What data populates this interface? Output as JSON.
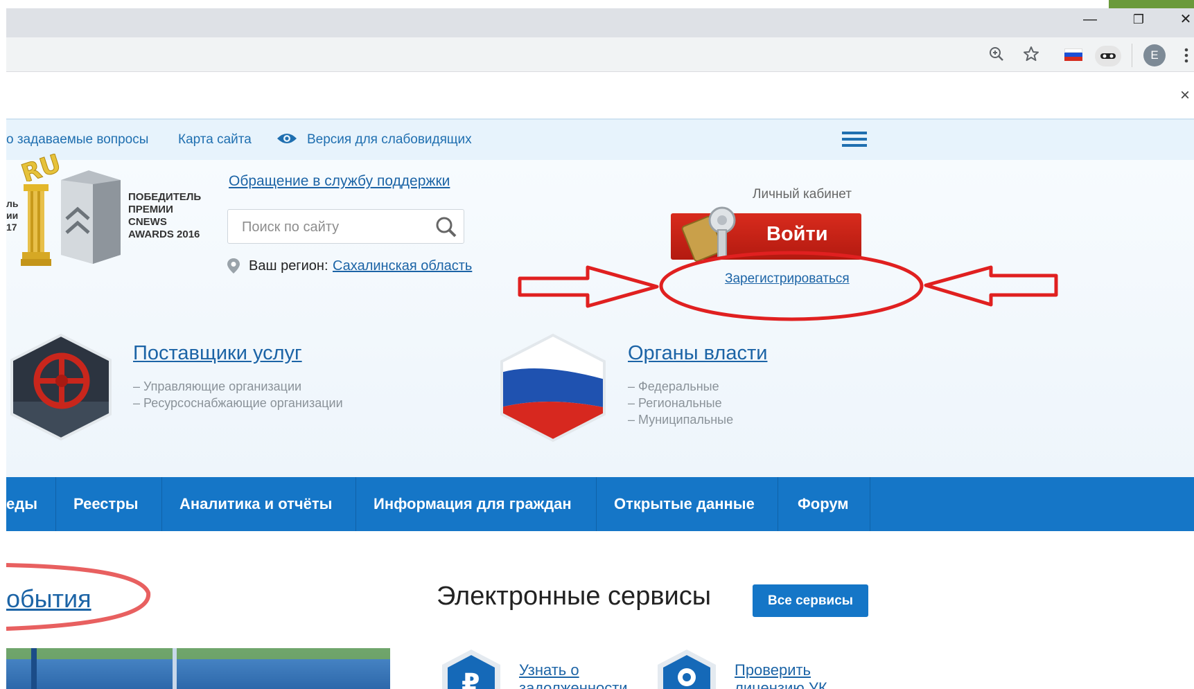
{
  "browser": {
    "minimize_glyph": "—",
    "restore_glyph": "❐",
    "close_glyph": "✕",
    "toolbar_icons": [
      "zoom-icon",
      "star-icon",
      "flag-ru-icon",
      "incognito-icon",
      "profile-avatar",
      "menu-dots-icon"
    ],
    "avatar_letter": "E",
    "infobar_close": "×"
  },
  "topnav": {
    "faq": "о задаваемые вопросы",
    "sitemap": "Карта сайта",
    "accessibility": "Версия для слабовидящих"
  },
  "award": {
    "badge": "RU",
    "text_lines": [
      "ПОБЕДИТЕЛЬ",
      "ПРЕМИИ",
      "CNEWS",
      "AWARDS 2016"
    ],
    "left_fragments": [
      "ль",
      "ии",
      "17"
    ]
  },
  "support_link": "Обращение в службу поддержки",
  "search": {
    "placeholder": "Поиск по сайту"
  },
  "region": {
    "label": "Ваш регион:",
    "value": "Сахалинская область"
  },
  "account": {
    "label": "Личный кабинет",
    "login": "Войти",
    "register": "Зарегистрироваться"
  },
  "categories": {
    "providers": {
      "title": "Поставщики услуг",
      "items": [
        "– Управляющие организации",
        "– Ресурсоснабжающие организации"
      ]
    },
    "authorities": {
      "title": "Органы власти",
      "items": [
        "– Федеральные",
        "– Региональные",
        "– Муниципальные"
      ]
    }
  },
  "mainnav": [
    "еды",
    "Реестры",
    "Аналитика и отчёты",
    "Информация для граждан",
    "Открытые данные",
    "Форум"
  ],
  "events_title": "обытия",
  "services": {
    "title": "Электронные сервисы",
    "all_button": "Все сервисы",
    "items": [
      {
        "line1": "Узнать о",
        "line2": "задолженности"
      },
      {
        "line1": "Проверить",
        "line2": "лицензию УК"
      }
    ]
  },
  "colors": {
    "accent_blue": "#1576c7",
    "login_red": "#c4231a",
    "annotation_red": "#e02020"
  }
}
